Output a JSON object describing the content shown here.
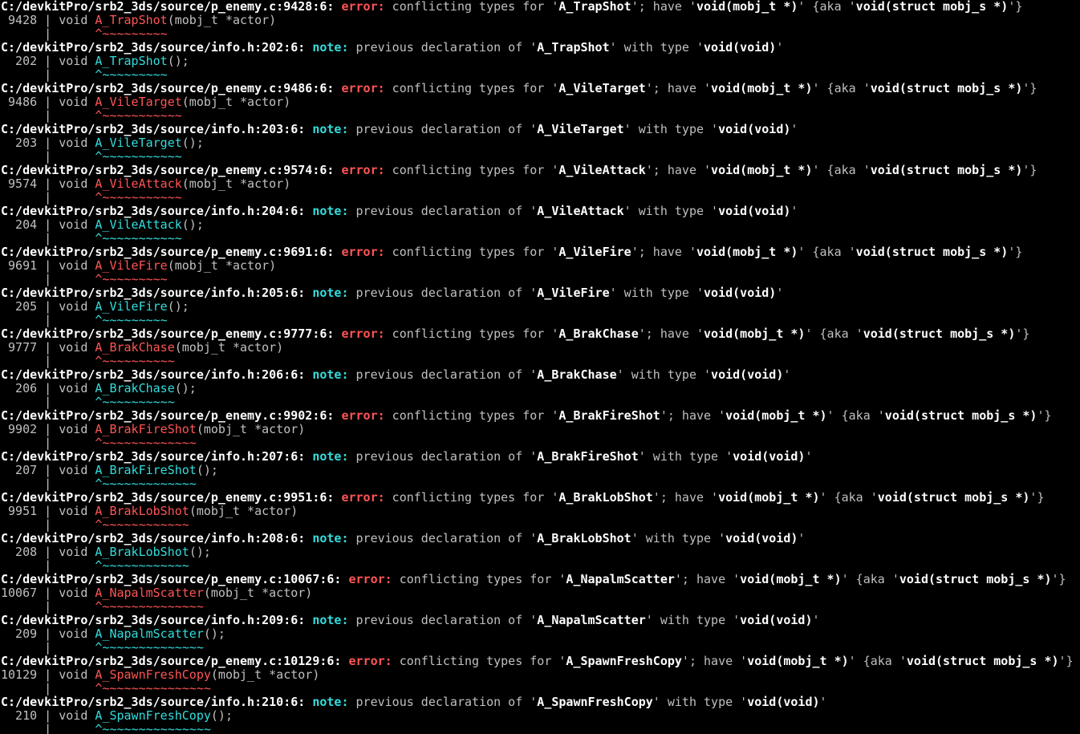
{
  "window": {
    "title": ""
  },
  "blocks": [
    {
      "err": {
        "path": "C:/devkitPro/srb2_3ds/source/p_enemy.c:9428:6:",
        "name": "A_TrapShot",
        "gutter": " 9428 | ",
        "carets": "^~~~~~~~~~"
      },
      "note": {
        "path": "C:/devkitPro/srb2_3ds/source/info.h:202:6:",
        "gutter": "  202 | ",
        "carets": "^~~~~~~~~~"
      }
    },
    {
      "err": {
        "path": "C:/devkitPro/srb2_3ds/source/p_enemy.c:9486:6:",
        "name": "A_VileTarget",
        "gutter": " 9486 | ",
        "carets": "^~~~~~~~~~~~"
      },
      "note": {
        "path": "C:/devkitPro/srb2_3ds/source/info.h:203:6:",
        "gutter": "  203 | ",
        "carets": "^~~~~~~~~~~~"
      }
    },
    {
      "err": {
        "path": "C:/devkitPro/srb2_3ds/source/p_enemy.c:9574:6:",
        "name": "A_VileAttack",
        "gutter": " 9574 | ",
        "carets": "^~~~~~~~~~~~"
      },
      "note": {
        "path": "C:/devkitPro/srb2_3ds/source/info.h:204:6:",
        "gutter": "  204 | ",
        "carets": "^~~~~~~~~~~~"
      }
    },
    {
      "err": {
        "path": "C:/devkitPro/srb2_3ds/source/p_enemy.c:9691:6:",
        "name": "A_VileFire",
        "gutter": " 9691 | ",
        "carets": "^~~~~~~~~~"
      },
      "note": {
        "path": "C:/devkitPro/srb2_3ds/source/info.h:205:6:",
        "gutter": "  205 | ",
        "carets": "^~~~~~~~~~"
      }
    },
    {
      "err": {
        "path": "C:/devkitPro/srb2_3ds/source/p_enemy.c:9777:6:",
        "name": "A_BrakChase",
        "gutter": " 9777 | ",
        "carets": "^~~~~~~~~~~"
      },
      "note": {
        "path": "C:/devkitPro/srb2_3ds/source/info.h:206:6:",
        "gutter": "  206 | ",
        "carets": "^~~~~~~~~~~"
      }
    },
    {
      "err": {
        "path": "C:/devkitPro/srb2_3ds/source/p_enemy.c:9902:6:",
        "name": "A_BrakFireShot",
        "gutter": " 9902 | ",
        "carets": "^~~~~~~~~~~~~~"
      },
      "note": {
        "path": "C:/devkitPro/srb2_3ds/source/info.h:207:6:",
        "gutter": "  207 | ",
        "carets": "^~~~~~~~~~~~~~"
      }
    },
    {
      "err": {
        "path": "C:/devkitPro/srb2_3ds/source/p_enemy.c:9951:6:",
        "name": "A_BrakLobShot",
        "gutter": " 9951 | ",
        "carets": "^~~~~~~~~~~~~"
      },
      "note": {
        "path": "C:/devkitPro/srb2_3ds/source/info.h:208:6:",
        "gutter": "  208 | ",
        "carets": "^~~~~~~~~~~~~"
      }
    },
    {
      "err": {
        "path": "C:/devkitPro/srb2_3ds/source/p_enemy.c:10067:6:",
        "name": "A_NapalmScatter",
        "gutter": "10067 | ",
        "carets": "^~~~~~~~~~~~~~~"
      },
      "note": {
        "path": "C:/devkitPro/srb2_3ds/source/info.h:209:6:",
        "gutter": "  209 | ",
        "carets": "^~~~~~~~~~~~~~~"
      }
    },
    {
      "err": {
        "path": "C:/devkitPro/srb2_3ds/source/p_enemy.c:10129:6:",
        "name": "A_SpawnFreshCopy",
        "gutter": "10129 | ",
        "carets": "^~~~~~~~~~~~~~~~"
      },
      "note": {
        "path": "C:/devkitPro/srb2_3ds/source/info.h:210:6:",
        "gutter": "  210 | ",
        "carets": "^~~~~~~~~~~~~~~~"
      }
    }
  ],
  "strings": {
    "error_label": "error:",
    "note_label": "note:",
    "conflicting": " conflicting types for '",
    "have": "'; have '",
    "have_type": "void(mobj_t *)",
    "aka_open": "' {aka '",
    "aka_type": "void(struct mobj_s *)",
    "aka_close": "'}",
    "prev_decl": " previous declaration of '",
    "with_type": "' with type '",
    "void_void": "void(void)",
    "quote": "'",
    "void_kw": "void ",
    "def_params": "(mobj_t *actor)",
    "decl_params": "();",
    "blank_gutter": "      | "
  },
  "colors": {
    "background": "#000000",
    "text": "#c0c0c0",
    "bold": "#ffffff",
    "error": "#ff5555",
    "note": "#33dddd"
  }
}
